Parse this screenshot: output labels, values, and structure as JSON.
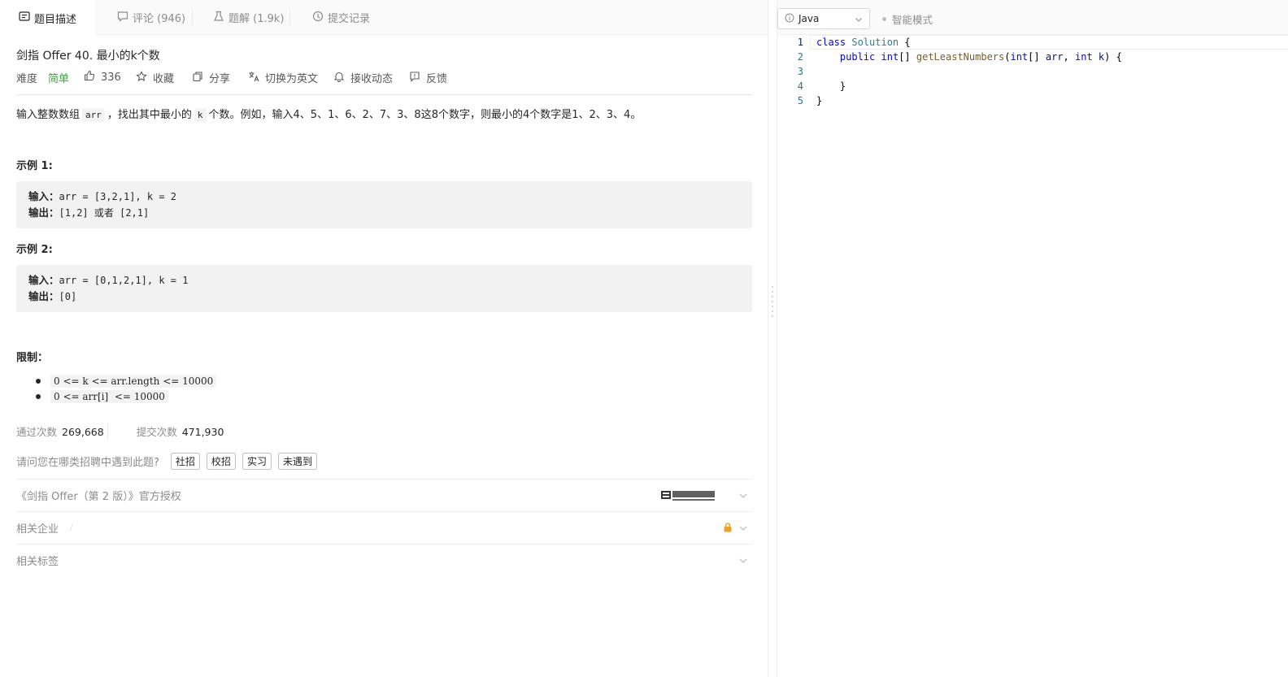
{
  "tabs": [
    {
      "label": "题目描述"
    },
    {
      "label": "评论 (946)"
    },
    {
      "label": "题解 (1.9k)"
    },
    {
      "label": "提交记录"
    }
  ],
  "problem": {
    "title": "剑指 Offer 40. 最小的k个数",
    "difficulty_label": "难度",
    "difficulty": "简单",
    "likes": "336",
    "actions": [
      "收藏",
      "分享",
      "切换为英文",
      "接收动态",
      "反馈"
    ]
  },
  "description": {
    "p1": "输入整数数组",
    "c1": "arr",
    "p2": "，找出其中最小的",
    "c2": "k",
    "p3": "个数。例如，输入4、5、1、6、2、7、3、8这8个数字，则最小的4个数字是1、2、3、4。"
  },
  "examples": [
    {
      "title": "示例 1:",
      "input_label": "输入：",
      "input": "arr = [3,2,1], k = 2",
      "output_label": "输出：",
      "output": "[1,2] 或者 [2,1]"
    },
    {
      "title": "示例 2:",
      "input_label": "输入：",
      "input": "arr = [0,1,2,1], k = 1",
      "output_label": "输出：",
      "output": "[0]"
    }
  ],
  "limits": {
    "title": "限制：",
    "items": [
      "0 <= k <= arr.length <= 10000",
      "0 <= arr[i]  <= 10000"
    ]
  },
  "stats": {
    "accepted_label": "通过次数",
    "accepted": "269,668",
    "submitted_label": "提交次数",
    "submitted": "471,930"
  },
  "survey": {
    "question": "请问您在哪类招聘中遇到此题?",
    "options": [
      "社招",
      "校招",
      "实习",
      "未遇到"
    ]
  },
  "sections": {
    "license": "《剑指 Offer（第 2 版）》官方授权",
    "publisher_logo_text": "電子工業出版社",
    "companies": "相关企业",
    "tags": "相关标签"
  },
  "editor": {
    "language": "Java",
    "smart_mode": "智能模式",
    "line_numbers": [
      "1",
      "2",
      "3",
      "4",
      "5"
    ],
    "code_lines": [
      "class Solution {",
      "    public int[] getLeastNumbers(int[] arr, int k) {",
      "",
      "    }",
      "}"
    ]
  },
  "colors": {
    "accent_green": "#43a047",
    "lock_orange": "#f0a020",
    "keyword_blue": "#0000ff",
    "type_teal": "#267f99",
    "function_brown": "#795e26"
  }
}
